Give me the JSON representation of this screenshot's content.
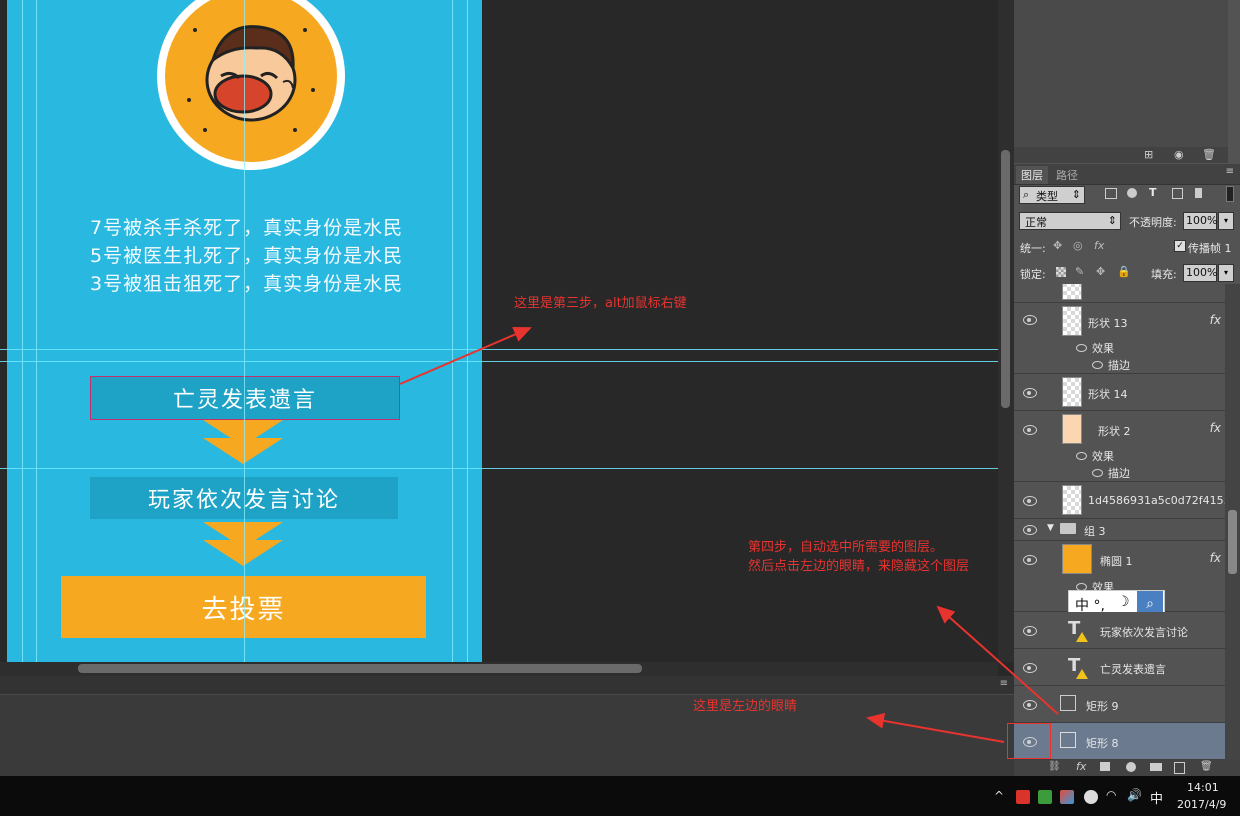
{
  "canvas": {
    "story_lines": [
      "7号被杀手杀死了，真实身份是水民",
      "5号被医生扎死了，真实身份是水民",
      "3号被狙击狙死了，真实身份是水民"
    ],
    "flow": {
      "step1": "亡灵发表遗言",
      "step2": "玩家依次发言讨论",
      "step3": "去投票"
    },
    "colors": {
      "artboard": "#29b8e0",
      "box": "#1ea3c7",
      "accent": "#f6a821"
    }
  },
  "annotations": {
    "step3": "这里是第三步，alt加鼠标右键",
    "step4_line1": "第四步，自动选中所需要的图层。",
    "step4_line2": "然后点击左边的眼睛，来隐藏这个图层",
    "left_eye": "这里是左边的眼睛",
    "color": "#e8332f"
  },
  "layers_panel": {
    "tabs": [
      "图层",
      "路径"
    ],
    "filter_kind": "类型",
    "blend_mode": "正常",
    "opacity_label": "不透明度:",
    "opacity_value": "100%",
    "unify_label": "统一:",
    "propagate_label": "传播帧 1",
    "lock_label": "锁定:",
    "fill_label": "填充:",
    "fill_value": "100%",
    "effects_label": "效果",
    "stroke_label": "描边",
    "layers": [
      {
        "name": "形状 13",
        "fx": true
      },
      {
        "name": "形状 14",
        "fx": false
      },
      {
        "name": "形状 2",
        "fx": true
      },
      {
        "name": "1d4586931a5c0d72f415...",
        "fx": false
      },
      {
        "name": "组 3",
        "fx": false
      },
      {
        "name": "椭圆 1",
        "fx": true
      },
      {
        "name": "玩家依次发言讨论",
        "fx": false
      },
      {
        "name": "亡灵发表遗言",
        "fx": false
      },
      {
        "name": "矩形 9",
        "fx": false
      },
      {
        "name": "矩形 8",
        "fx": false
      }
    ]
  },
  "ime_bar": {
    "label": "中 °,"
  },
  "taskbar": {
    "ime": "中",
    "time": "14:01",
    "date": "2017/4/9"
  }
}
